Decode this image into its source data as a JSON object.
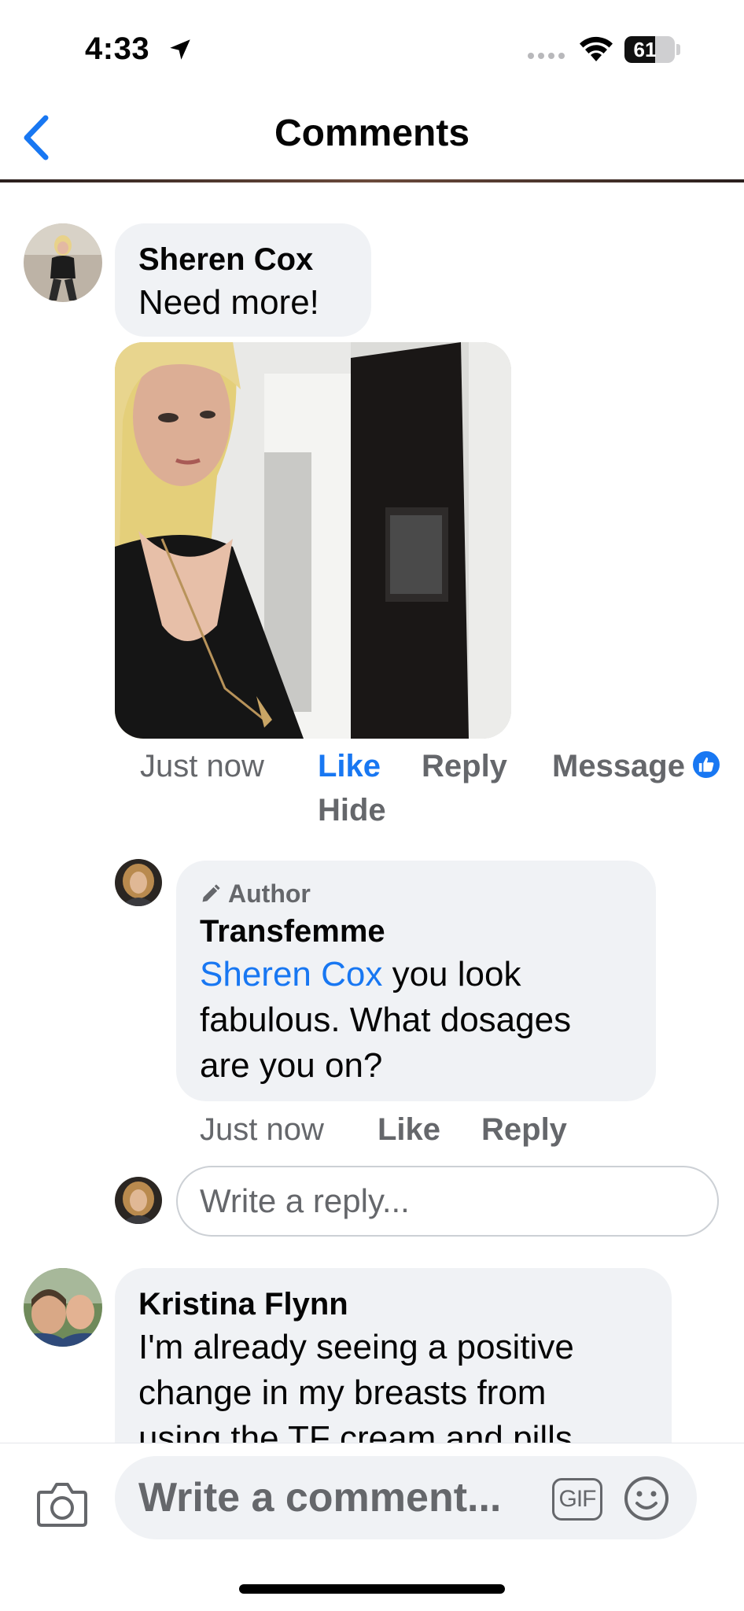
{
  "status_bar": {
    "time": "4:33",
    "battery": "61",
    "battery_level": 0.61
  },
  "header": {
    "title": "Comments"
  },
  "comments": [
    {
      "author": "Sheren Cox",
      "text": "Need more!",
      "has_photo": true,
      "time": "Just now",
      "actions": {
        "like": "Like",
        "reply": "Reply",
        "message": "Message",
        "hide": "Hide"
      },
      "liked": true
    },
    {
      "badge": "Author",
      "author": "Transfemme",
      "mention": "Sheren Cox",
      "text_line1": " you look",
      "text_line2": "fabulous. What dosages",
      "text_line3": "are you on?",
      "time": "Just now",
      "actions": {
        "like": "Like",
        "reply": "Reply"
      }
    },
    {
      "author": "Kristina Flynn",
      "text_line1": "I'm already seeing a positive",
      "text_line2": "change in my breasts from",
      "text_line3": "using the TF cream and pills"
    }
  ],
  "reply_input": {
    "placeholder": "Write a reply..."
  },
  "composer": {
    "placeholder": "Write a comment...",
    "gif_label": "GIF"
  },
  "colors": {
    "accent": "#1877f2",
    "bubble": "#f0f2f5",
    "meta_text": "#65676b"
  },
  "icons": [
    "location-arrow-icon",
    "wifi-icon",
    "back-chevron-icon",
    "pencil-icon",
    "thumbs-up-icon",
    "camera-icon",
    "gif-icon",
    "smiley-icon"
  ]
}
